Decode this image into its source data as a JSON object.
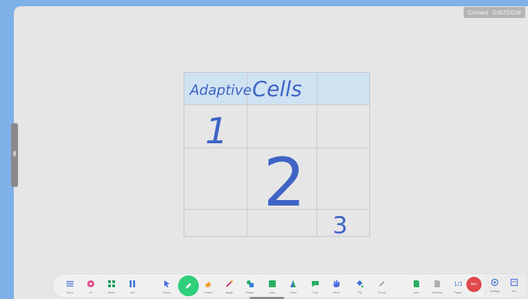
{
  "connect": {
    "label": "Connect",
    "code": "GWZDGW"
  },
  "table": {
    "header": [
      "Adaptive",
      "Cells",
      ""
    ],
    "cells": [
      "1",
      "2",
      "3"
    ]
  },
  "toolbar": {
    "items": [
      {
        "name": "menu",
        "label": "Menu",
        "icon": "menu-icon",
        "color": "#5b7fd6"
      },
      {
        "name": "ai",
        "label": "AI",
        "icon": "flower-icon",
        "color": "#e04a8a"
      },
      {
        "name": "share",
        "label": "Share",
        "icon": "grid-icon",
        "color": "#1f9f5f"
      },
      {
        "name": "list",
        "label": "List",
        "icon": "columns-icon",
        "color": "#4a78d8"
      },
      {
        "name": "arrow",
        "label": "Arrow",
        "icon": "cursor-icon",
        "color": "#4a6fe0"
      },
      {
        "name": "pen",
        "label": "Pen",
        "icon": "pen-icon",
        "color": "#ffffff"
      },
      {
        "name": "eraser",
        "label": "Eraser",
        "icon": "eraser-icon",
        "color": "#f0a030"
      },
      {
        "name": "magic",
        "label": "Magic",
        "icon": "wand-icon",
        "color": "#c0306a"
      },
      {
        "name": "shape",
        "label": "Shape",
        "icon": "shapes-icon",
        "color": "#2f7fe0"
      },
      {
        "name": "note",
        "label": "Note",
        "icon": "note-icon",
        "color": "#28b060"
      },
      {
        "name": "chart",
        "label": "Chart",
        "icon": "triangle-icon",
        "color": "#3a6ed8"
      },
      {
        "name": "chat",
        "label": "Chat",
        "icon": "chat-icon",
        "color": "#28b060"
      },
      {
        "name": "hand",
        "label": "Hand",
        "icon": "hand-icon",
        "color": "#4a6fe0"
      },
      {
        "name": "fill",
        "label": "Fill",
        "icon": "bucket-icon",
        "color": "#3a6ed8"
      },
      {
        "name": "pencil",
        "label": "Pencil",
        "icon": "pencil-icon",
        "color": "#b0b0b0"
      },
      {
        "name": "add",
        "label": "Add",
        "icon": "page-icon",
        "color": "#28b060"
      },
      {
        "name": "remove",
        "label": "Remove",
        "icon": "page-gray-icon",
        "color": "#b0b0b0"
      },
      {
        "name": "pages",
        "label": "Pages",
        "icon": "page-count-icon",
        "color": "#3a6ed8"
      }
    ],
    "page_count": "1/1",
    "rec_label": "Rec",
    "right": [
      {
        "name": "settings",
        "label": "Settings",
        "icon": "settings-icon",
        "color": "#4a78d8"
      },
      {
        "name": "exit",
        "label": "Exit",
        "icon": "exit-icon",
        "color": "#4a78d8"
      }
    ]
  }
}
